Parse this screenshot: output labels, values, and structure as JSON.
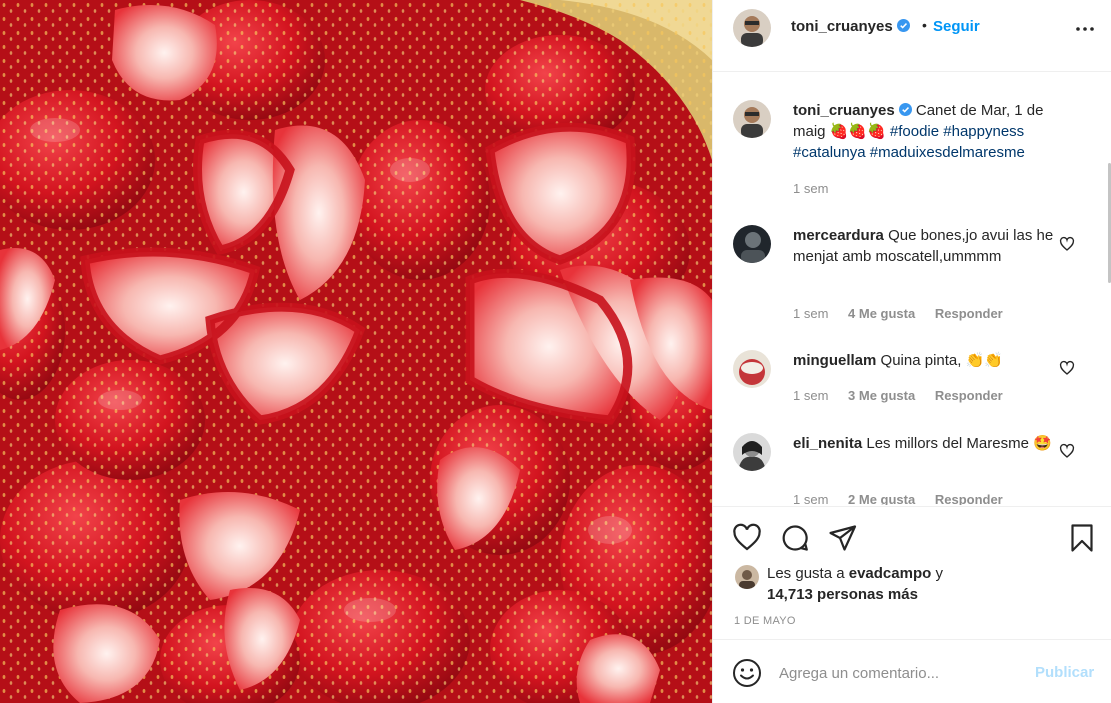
{
  "post": {
    "author": "toni_cruanyes",
    "follow_label": "Seguir",
    "separator": "•",
    "more_icon": "more-horizontal-icon",
    "verified_icon": "verified-badge-icon",
    "photo_subject": "strawberries"
  },
  "caption": {
    "user": "toni_cruanyes",
    "text_before": " Canet de Mar, 1 de maig ",
    "emojis": "🍓🍓🍓",
    "hashtags": [
      "#foodie",
      "#happyness",
      "#catalunya",
      "#maduixesdelmaresme"
    ],
    "time": "1 sem"
  },
  "comments": [
    {
      "user": "merceardura",
      "text": "Que bones,jo avui las he menjat amb moscatell,ummmm",
      "time": "1 sem",
      "likes": "4 Me gusta",
      "reply": "Responder"
    },
    {
      "user": "minguellam",
      "text": "Quina pinta, 👏👏",
      "time": "1 sem",
      "likes": "3 Me gusta",
      "reply": "Responder"
    },
    {
      "user": "eli_nenita",
      "text": "Les millors del Maresme 🤩",
      "time": "1 sem",
      "likes": "2 Me gusta",
      "reply": "Responder"
    }
  ],
  "actions": {
    "like_icon": "heart-icon",
    "comment_icon": "comment-bubble-icon",
    "share_icon": "send-icon",
    "save_icon": "bookmark-icon"
  },
  "likes": {
    "prefix": "Les gusta a ",
    "user": "evadcampo",
    "suffix": " y",
    "count_text": "14,713 personas más"
  },
  "date": "1 DE MAYO",
  "add_comment": {
    "placeholder": "Agrega un comentario...",
    "publish_label": "Publicar",
    "emoji_icon": "smiley-face-icon"
  },
  "colors": {
    "link_blue": "#0095f6",
    "publish_disabled": "#b2dffc",
    "hashtag": "#00376b",
    "muted": "#8e8e8e",
    "strawberry_red": "#d7141e"
  }
}
